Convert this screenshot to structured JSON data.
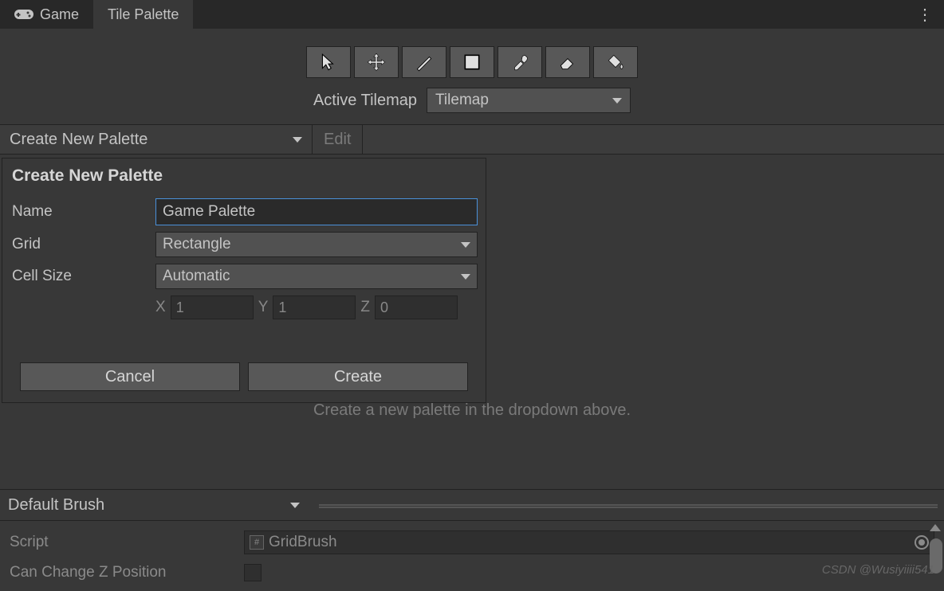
{
  "tabs": {
    "game": "Game",
    "tile_palette": "Tile Palette"
  },
  "toolbar": {
    "tools": [
      "select",
      "move",
      "brush",
      "box",
      "picker",
      "eraser",
      "fill"
    ]
  },
  "active_tilemap": {
    "label": "Active Tilemap",
    "value": "Tilemap"
  },
  "palette_bar": {
    "dropdown_label": "Create New Palette",
    "edit_label": "Edit"
  },
  "popup": {
    "title": "Create New Palette",
    "name_label": "Name",
    "name_value": "Game Palette",
    "grid_label": "Grid",
    "grid_value": "Rectangle",
    "cellsize_label": "Cell Size",
    "cellsize_value": "Automatic",
    "x_label": "X",
    "x_value": "1",
    "y_label": "Y",
    "y_value": "1",
    "z_label": "Z",
    "z_value": "0",
    "cancel_label": "Cancel",
    "create_label": "Create"
  },
  "hint": "Create a new palette in the dropdown above.",
  "brush": {
    "dropdown_value": "Default Brush"
  },
  "props": {
    "script_label": "Script",
    "script_value": "GridBrush",
    "can_change_z_label": "Can Change Z Position"
  },
  "watermark": "CSDN @Wusiyiiii541"
}
